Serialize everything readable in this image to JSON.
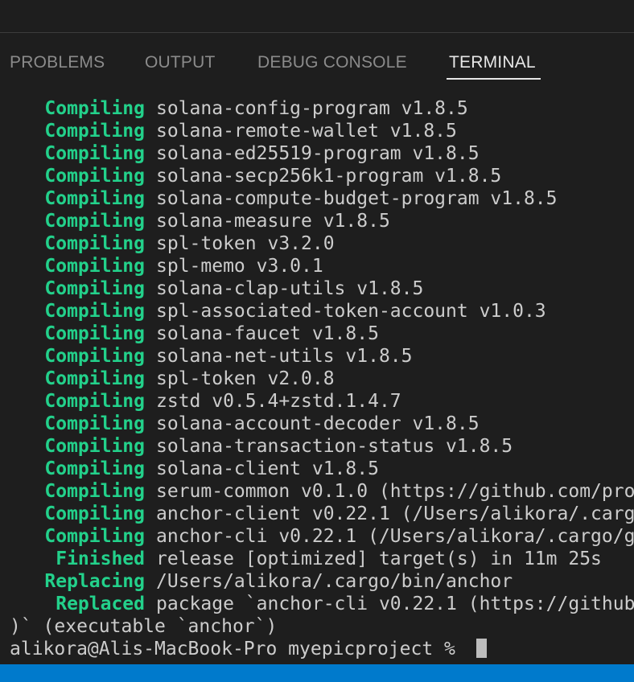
{
  "tabs": [
    {
      "label": "PROBLEMS"
    },
    {
      "label": "OUTPUT"
    },
    {
      "label": "DEBUG CONSOLE"
    },
    {
      "label": "TERMINAL"
    }
  ],
  "active_tab": "TERMINAL",
  "terminal": {
    "lines": [
      {
        "verb": "Compiling",
        "text": "solana-config-program v1.8.5"
      },
      {
        "verb": "Compiling",
        "text": "solana-remote-wallet v1.8.5"
      },
      {
        "verb": "Compiling",
        "text": "solana-ed25519-program v1.8.5"
      },
      {
        "verb": "Compiling",
        "text": "solana-secp256k1-program v1.8.5"
      },
      {
        "verb": "Compiling",
        "text": "solana-compute-budget-program v1.8.5"
      },
      {
        "verb": "Compiling",
        "text": "solana-measure v1.8.5"
      },
      {
        "verb": "Compiling",
        "text": "spl-token v3.2.0"
      },
      {
        "verb": "Compiling",
        "text": "spl-memo v3.0.1"
      },
      {
        "verb": "Compiling",
        "text": "solana-clap-utils v1.8.5"
      },
      {
        "verb": "Compiling",
        "text": "spl-associated-token-account v1.0.3"
      },
      {
        "verb": "Compiling",
        "text": "solana-faucet v1.8.5"
      },
      {
        "verb": "Compiling",
        "text": "solana-net-utils v1.8.5"
      },
      {
        "verb": "Compiling",
        "text": "spl-token v2.0.8"
      },
      {
        "verb": "Compiling",
        "text": "zstd v0.5.4+zstd.1.4.7"
      },
      {
        "verb": "Compiling",
        "text": "solana-account-decoder v1.8.5"
      },
      {
        "verb": "Compiling",
        "text": "solana-transaction-status v1.8.5"
      },
      {
        "verb": "Compiling",
        "text": "solana-client v1.8.5"
      },
      {
        "verb": "Compiling",
        "text": "serum-common v0.1.0 (https://github.com/pro"
      },
      {
        "verb": "Compiling",
        "text": "anchor-client v0.22.1 (/Users/alikora/.carg"
      },
      {
        "verb": "Compiling",
        "text": "anchor-cli v0.22.1 (/Users/alikora/.cargo/g"
      },
      {
        "verb": "Finished",
        "text": "release [optimized] target(s) in 11m 25s"
      },
      {
        "verb": "Replacing",
        "text": "/Users/alikora/.cargo/bin/anchor"
      },
      {
        "verb": "Replaced",
        "text": "package `anchor-cli v0.22.1 (https://github"
      }
    ],
    "continuation": ")` (executable `anchor`)",
    "prompt": "alikora@Alis-MacBook-Pro myepicproject % "
  },
  "colors": {
    "background": "#1e1e1e",
    "verb_green": "#23d18b",
    "text": "#cccccc",
    "statusbar": "#007acc"
  }
}
